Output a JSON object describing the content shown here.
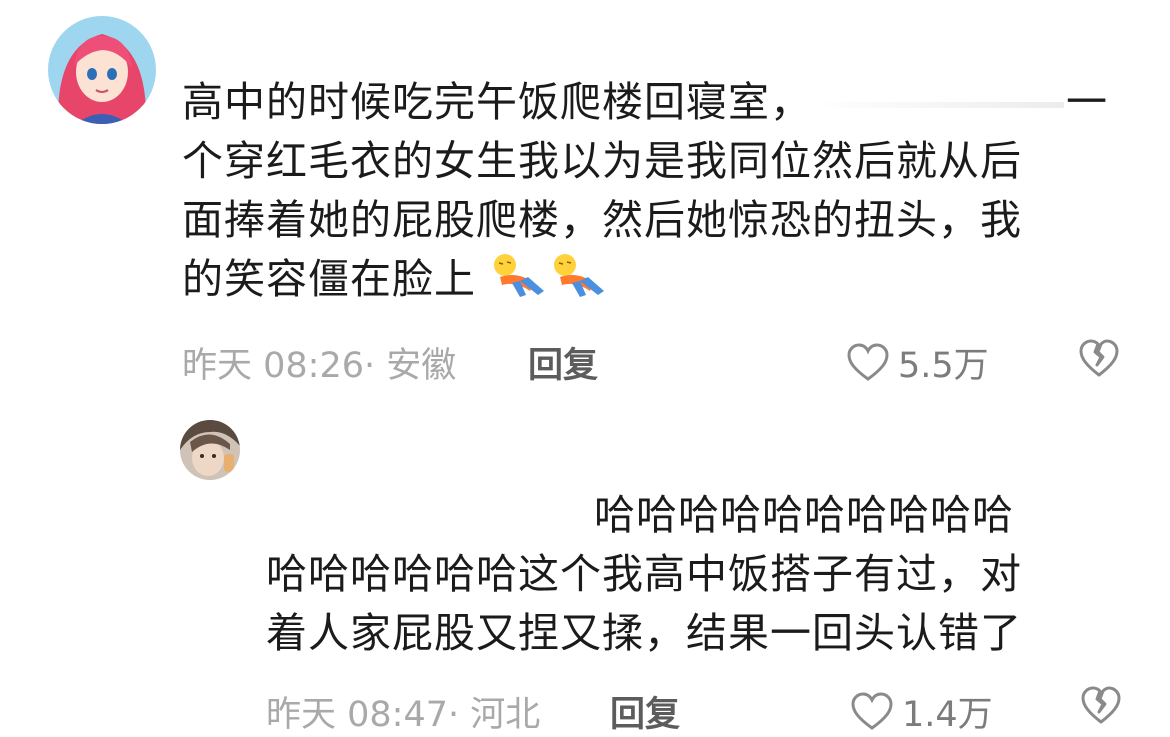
{
  "comments": [
    {
      "text_lines": [
        "高中的时候吃完午饭爬楼回寝室，",
        "一",
        "个穿红毛衣的女生我以为是我同位然后就从后",
        "面捧着她的屁股爬楼，然后她惊恐的扭头，我",
        "的笑容僵在脸上"
      ],
      "time": "昨天 08:26",
      "location": "· 安徽",
      "reply_label": "回复",
      "likes": "5.5万"
    },
    {
      "text_lines": [
        "哈哈哈哈哈哈哈哈哈哈",
        "哈哈哈哈哈哈这个我高中饭搭子有过，对",
        "着人家屁股又捏又揉，结果一回头认错了"
      ],
      "time": "昨天 08:47",
      "location": "· 河北",
      "reply_label": "回复",
      "likes": "1.4万"
    }
  ],
  "icons": {
    "like": "heart-outline-icon",
    "dislike": "broken-heart-icon",
    "emoji": "lying-down-emoji"
  },
  "colors": {
    "text": "#1b1b1b",
    "meta": "#a9a9a9",
    "reply": "#5c5c5c",
    "icon": "#8a8a8a"
  }
}
